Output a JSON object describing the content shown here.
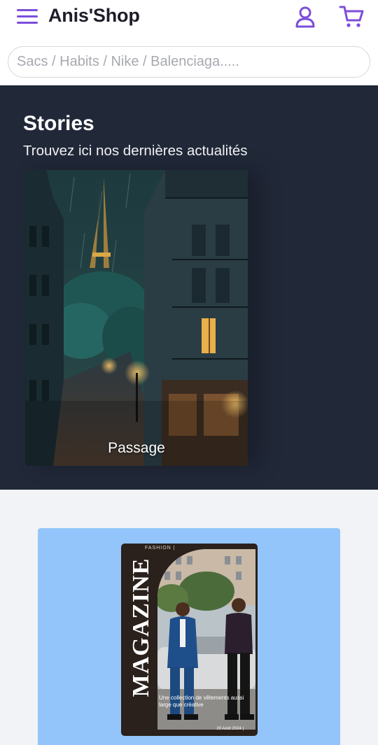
{
  "header": {
    "brand": "Anis'Shop",
    "menu_icon": "hamburger-icon",
    "user_icon": "user-icon",
    "cart_icon": "cart-icon",
    "accent_color": "#7c4ddb"
  },
  "search": {
    "placeholder": "Sacs / Habits / Nike / Balenciaga.....",
    "value": ""
  },
  "stories": {
    "title": "Stories",
    "subtitle": "Trouvez ici nos dernières actualités",
    "background": "#212838",
    "items": [
      {
        "label": "Passage"
      }
    ]
  },
  "magazine": {
    "panel_color": "#93c5fb",
    "cover_title": "MAGAZINE",
    "cover_kicker": "FASHION |",
    "cover_caption": "Une collection de vêtements aussi large que créative",
    "cover_date": "20 Août 2024 |"
  }
}
